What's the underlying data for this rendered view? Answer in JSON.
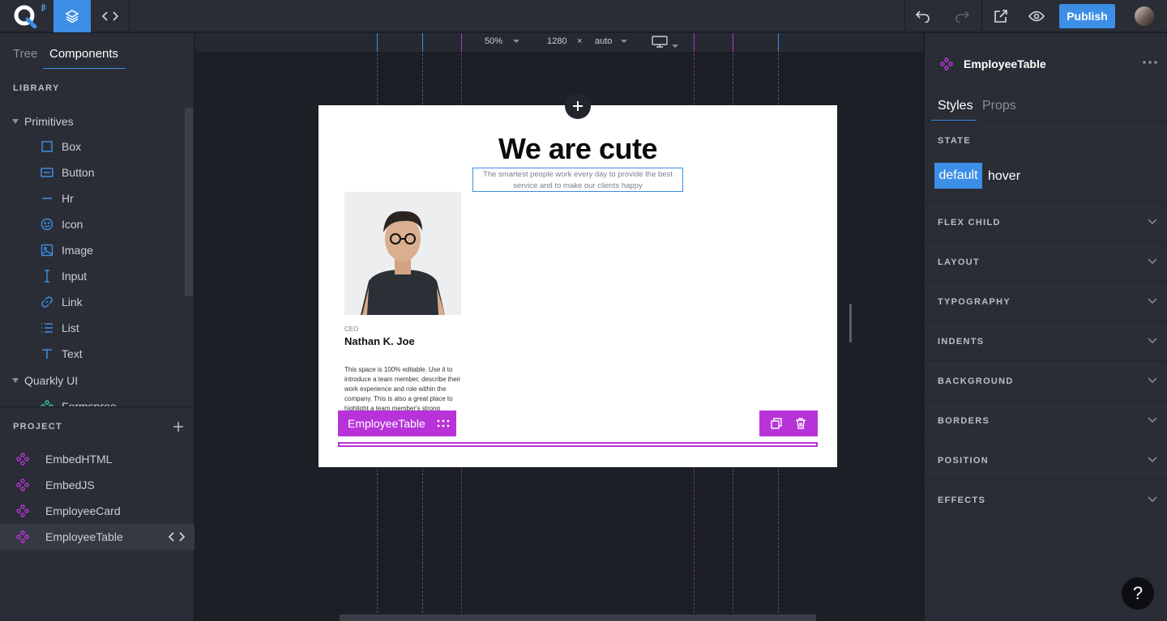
{
  "topbar": {
    "logo_beta": "β",
    "publish_label": "Publish"
  },
  "left": {
    "tabs": [
      "Tree",
      "Components"
    ],
    "library_title": "LIBRARY",
    "primitives_label": "Primitives",
    "primitives": [
      {
        "label": "Box",
        "icon": "box-icon"
      },
      {
        "label": "Button",
        "icon": "button-icon"
      },
      {
        "label": "Hr",
        "icon": "hr-icon"
      },
      {
        "label": "Icon",
        "icon": "smiley-icon"
      },
      {
        "label": "Image",
        "icon": "image-icon"
      },
      {
        "label": "Input",
        "icon": "text-cursor-icon"
      },
      {
        "label": "Link",
        "icon": "link-icon"
      },
      {
        "label": "List",
        "icon": "list-icon"
      },
      {
        "label": "Text",
        "icon": "text-icon"
      }
    ],
    "quarkly_label": "Quarkly UI",
    "quarkly_first": "Formspree",
    "project_title": "PROJECT",
    "project_items": [
      "EmbedHTML",
      "EmbedJS",
      "EmployeeCard",
      "EmployeeTable"
    ]
  },
  "canvas": {
    "zoom": "50%",
    "width": "1280",
    "times": "×",
    "height": "auto",
    "page": {
      "title": "We are cute",
      "subtitle": "The smartest people work every day to provide the best service and to make our clients happy",
      "role": "CEO",
      "name": "Nathan K. Joe",
      "bio": "This space is 100% editable. Use it to introduce a team member, describe their work experience and role within the company. This is also a great place to highlight a team member's strong"
    },
    "selection_label": "EmployeeTable"
  },
  "right": {
    "component_name": "EmployeeTable",
    "tabs": [
      "Styles",
      "Props"
    ],
    "state_title": "STATE",
    "state_default": "default",
    "state_hover": "hover",
    "sections": [
      "FLEX CHILD",
      "LAYOUT",
      "TYPOGRAPHY",
      "INDENTS",
      "BACKGROUND",
      "BORDERS",
      "POSITION",
      "EFFECTS"
    ]
  },
  "help_label": "?",
  "colors": {
    "accent": "#3c8ee6",
    "component": "#b733d8"
  }
}
